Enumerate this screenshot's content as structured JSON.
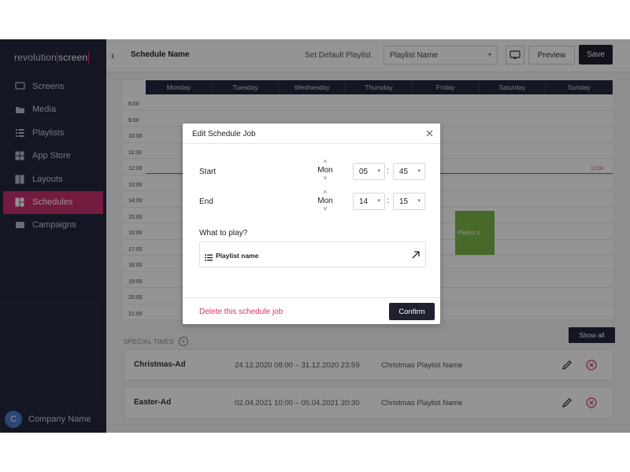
{
  "sidebar": {
    "logo_main": "revolution",
    "logo_accent": "screen",
    "items": [
      {
        "label": "Screens",
        "icon": "monitor-icon"
      },
      {
        "label": "Media",
        "icon": "folder-icon"
      },
      {
        "label": "Playlists",
        "icon": "playlist-icon"
      },
      {
        "label": "App Store",
        "icon": "grid-icon"
      },
      {
        "label": "Layouts",
        "icon": "layout-icon"
      },
      {
        "label": "Schedules",
        "icon": "calendar-icon",
        "active": true
      },
      {
        "label": "Campaigns",
        "icon": "campaign-icon"
      }
    ],
    "company": {
      "initial": "C",
      "name": "Company Name"
    }
  },
  "topbar": {
    "back_icon": "chevron-left-icon",
    "schedule_name": "Schedule Name",
    "set_default_label": "Set Default Playlist",
    "playlist_select_value": "Playlist Name",
    "preview_label": "Preview",
    "save_label": "Save"
  },
  "calendar": {
    "days": [
      "Monday",
      "Tuesday",
      "Wednesday",
      "Thursday",
      "Friday",
      "Saturday",
      "Sunday"
    ],
    "hours": [
      "8:00",
      "9:00",
      "10:00",
      "11:00",
      "12:00",
      "13:00",
      "14:00",
      "15:00",
      "16:00",
      "17:00",
      "18:00",
      "19:00",
      "20:00",
      "21:00"
    ],
    "now_label": "12:00",
    "event_label": "Playlist 2"
  },
  "special": {
    "heading": "SPECIAL TIMES",
    "show_all_label": "Show all",
    "rows": [
      {
        "name": "Christmas-Ad",
        "dates": "24.12.2020 08:00 – 31.12.2020 23:59",
        "playlist": "Christmas Playlist Name"
      },
      {
        "name": "Easter-Ad",
        "dates": "02.04.2021 10:00 – 05.04.2021 20:30",
        "playlist": "Christmas Playlist Name"
      }
    ]
  },
  "modal": {
    "title": "Edit Schedule Job",
    "start": {
      "label": "Start",
      "day": "Mon",
      "hour": "05",
      "minute": "45"
    },
    "end": {
      "label": "End",
      "day": "Mon",
      "hour": "14",
      "minute": "15"
    },
    "colon": ":",
    "what_label": "What to play?",
    "playlist_name": "Playlist name",
    "delete_label": "Delete this schedule job",
    "confirm_label": "Confirm"
  },
  "colors": {
    "sidebar_bg": "#25273f",
    "accent": "#c8306f",
    "event_green": "#7ab648",
    "now_line": "#d8385f"
  }
}
